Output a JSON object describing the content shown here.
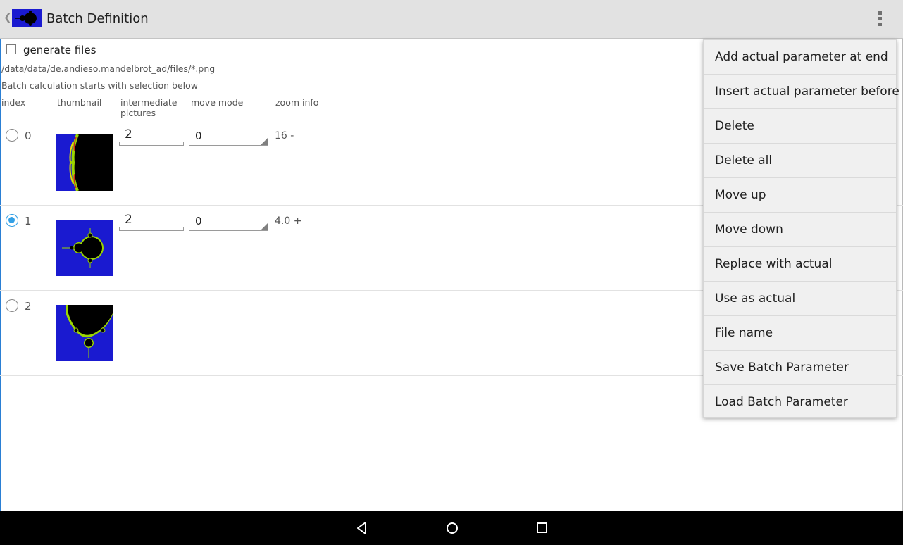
{
  "actionbar": {
    "title": "Batch Definition",
    "back_icon": "chevron-left-icon",
    "overflow_icon": "more-vertical-icon"
  },
  "settings": {
    "generate_files_label": "generate files",
    "generate_files_checked": false,
    "path": "/data/data/de.andieso.mandelbrot_ad/files/*.png",
    "info": "Batch calculation starts with selection below"
  },
  "columns": {
    "index": "index",
    "thumbnail": "thumbnail",
    "intermediate_1": "intermediate",
    "intermediate_2": "pictures",
    "move_mode": "move mode",
    "zoom_info": "zoom info"
  },
  "rows": [
    {
      "index": "0",
      "selected": false,
      "intermediate": "2",
      "move_mode": "0",
      "zoom": "16 -"
    },
    {
      "index": "1",
      "selected": true,
      "intermediate": "2",
      "move_mode": "0",
      "zoom": "4.0 +"
    },
    {
      "index": "2",
      "selected": false
    }
  ],
  "menu": {
    "items": [
      "Add actual parameter at end",
      "Insert actual parameter before",
      "Delete",
      "Delete all",
      "Move up",
      "Move down",
      "Replace with actual",
      "Use as actual",
      "File name",
      "Save Batch Parameter",
      "Load Batch Parameter"
    ]
  },
  "navbar": {
    "back_icon": "back-triangle-icon",
    "home_icon": "home-circle-icon",
    "recents_icon": "recents-square-icon"
  },
  "colors": {
    "actionbar_bg": "#e2e2e2",
    "accent": "#33a0e6",
    "fractal_blue": "#1a1ad0",
    "fractal_edge": "#9bd600"
  }
}
